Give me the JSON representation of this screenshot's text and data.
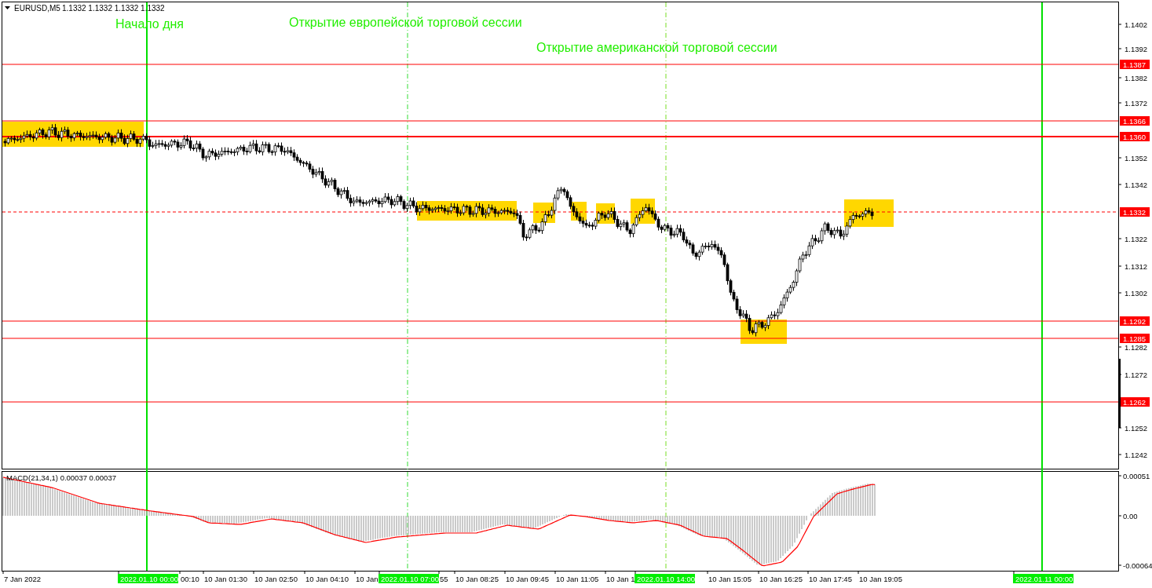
{
  "header": {
    "symbol": "EURUSD,M5",
    "quote": "1.1332 1.1332 1.1332 1.1332"
  },
  "annotations": [
    {
      "text": "Начало дня"
    },
    {
      "text": "Открытие европейской торговой сессии"
    },
    {
      "text": "Открытие американской торговой сессии"
    }
  ],
  "price_ticks": [
    "1.1402",
    "1.1392",
    "1.1382",
    "1.1372",
    "1.1352",
    "1.1342",
    "1.1322",
    "1.1312",
    "1.1302",
    "1.1282",
    "1.1272",
    "1.1252",
    "1.1242"
  ],
  "levels": [
    {
      "price": "1.1387",
      "kind": "solid"
    },
    {
      "price": "1.1366",
      "kind": "solid"
    },
    {
      "price": "1.1360",
      "kind": "thick"
    },
    {
      "price": "1.1332",
      "kind": "dashed"
    },
    {
      "price": "1.1292",
      "kind": "solid"
    },
    {
      "price": "1.1285",
      "kind": "solid"
    },
    {
      "price": "1.1262",
      "kind": "solid"
    }
  ],
  "macd": {
    "label": "MACD(21,34,1) 0.00037 0.00037",
    "ticks": [
      "0.00051",
      "0.00",
      "-0.00064"
    ]
  },
  "time_labels": [
    {
      "text": "7 Jan 2022",
      "highlighted": false
    },
    {
      "text": "2022.01.10 00:00",
      "highlighted": true
    },
    {
      "text": "00:10",
      "highlighted": false
    },
    {
      "text": "10 Jan 01:30",
      "highlighted": false
    },
    {
      "text": "10 Jan 02:50",
      "highlighted": false
    },
    {
      "text": "10 Jan 04:10",
      "highlighted": false
    },
    {
      "text": "10 Jan",
      "highlighted": false
    },
    {
      "text": "2022.01.10 07:00",
      "highlighted": true
    },
    {
      "text": "55",
      "highlighted": false
    },
    {
      "text": "10 Jan 08:25",
      "highlighted": false
    },
    {
      "text": "10 Jan 09:45",
      "highlighted": false
    },
    {
      "text": "10 Jan 11:05",
      "highlighted": false
    },
    {
      "text": "10 Jan 1",
      "highlighted": false
    },
    {
      "text": "2022.01.10 14:00",
      "highlighted": true
    },
    {
      "text": "10 Jan 15:05",
      "highlighted": false
    },
    {
      "text": "10 Jan 16:25",
      "highlighted": false
    },
    {
      "text": "10 Jan 17:45",
      "highlighted": false
    },
    {
      "text": "10 Jan 19:05",
      "highlighted": false
    },
    {
      "text": "2022.01.11 00:00",
      "highlighted": true
    }
  ]
}
